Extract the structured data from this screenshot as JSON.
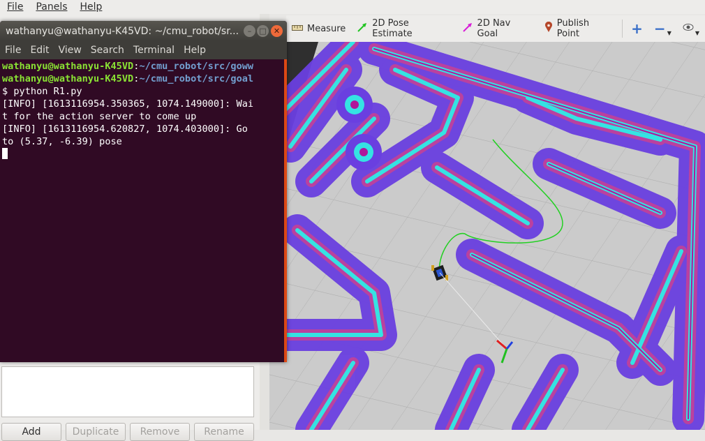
{
  "menubar": {
    "items": [
      "File",
      "Panels",
      "Help"
    ]
  },
  "toolbar": {
    "tools": [
      {
        "label": "Measure",
        "icon": "ruler-icon"
      },
      {
        "label": "2D Pose Estimate",
        "icon": "green-arrow-icon"
      },
      {
        "label": "2D Nav Goal",
        "icon": "magenta-arrow-icon"
      },
      {
        "label": "Publish Point",
        "icon": "map-pin-icon"
      }
    ],
    "icons": [
      "plus-icon",
      "minus-icon",
      "eye-icon"
    ]
  },
  "left_panel": {
    "buttons": {
      "add": "Add",
      "duplicate": "Duplicate",
      "remove": "Remove",
      "rename": "Rename"
    }
  },
  "terminal": {
    "title": "wathanyu@wathanyu-K45VD: ~/cmu_robot/sr...",
    "menu": [
      "File",
      "Edit",
      "View",
      "Search",
      "Terminal",
      "Help"
    ],
    "lines": [
      {
        "user": "wathanyu@wathanyu-K45VD",
        "sep": ":",
        "path": "~/cmu_robot/src/goww"
      },
      {
        "user": "wathanyu@wathanyu-K45VD",
        "sep": ":",
        "path": "~/cmu_robot/src/goal"
      },
      {
        "text": "$ python R1.py"
      },
      {
        "text": "[INFO] [1613116954.350365, 1074.149000]: Wai"
      },
      {
        "text": "t for the action server to come up"
      },
      {
        "text": "[INFO] [1613116954.620827, 1074.403000]: Go"
      },
      {
        "text": "to (5.37, -6.39) pose"
      }
    ]
  },
  "colors": {
    "terminal_bg": "#300a24",
    "costmap_inflation": "#6a3fe0",
    "costmap_lethal": "#35e3e3",
    "costmap_core": "#b0169a",
    "floor_grey": "#cbcbcb",
    "path_green": "#22d022"
  }
}
